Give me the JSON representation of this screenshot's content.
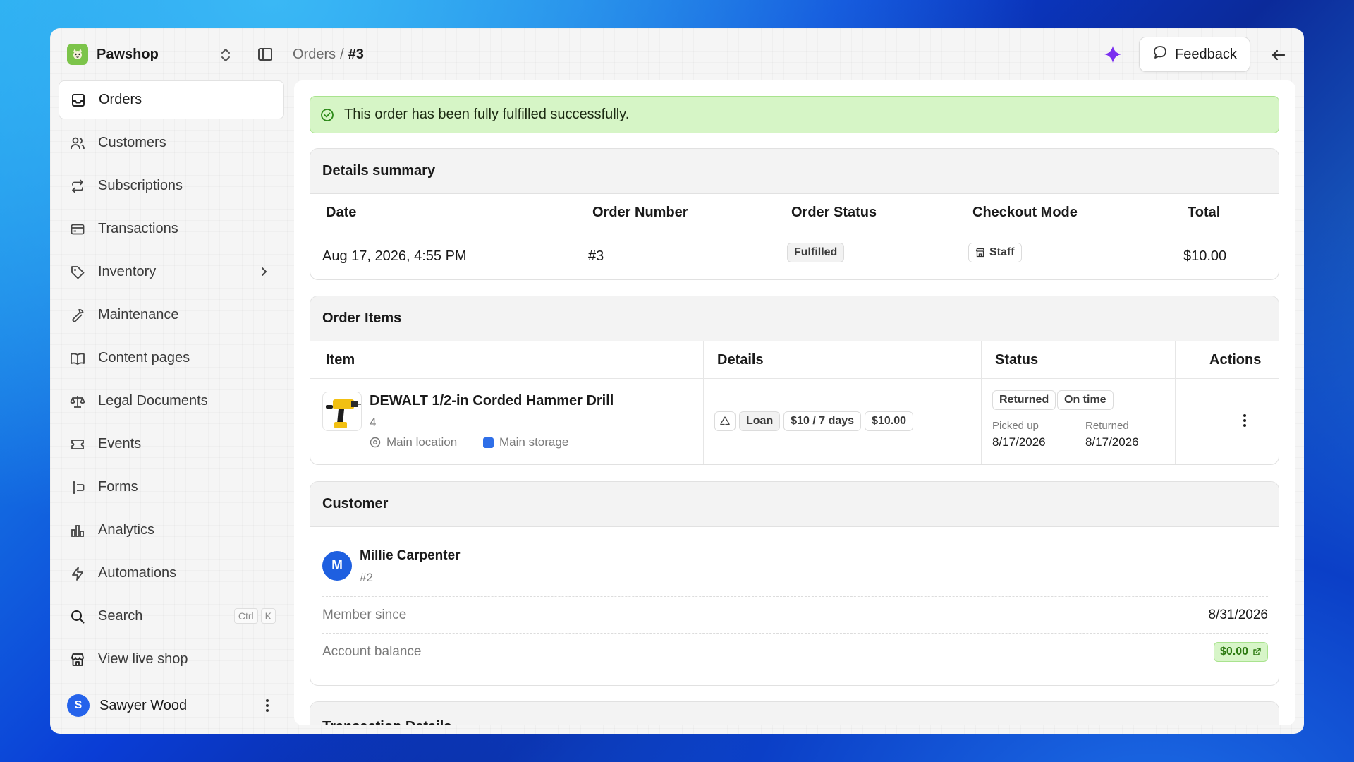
{
  "app": {
    "name": "Pawshop"
  },
  "breadcrumb": {
    "parent": "Orders",
    "separator": "/",
    "current": "#3"
  },
  "header": {
    "feedback_label": "Feedback"
  },
  "sidebar": {
    "items": [
      {
        "label": "Orders"
      },
      {
        "label": "Customers"
      },
      {
        "label": "Subscriptions"
      },
      {
        "label": "Transactions"
      },
      {
        "label": "Inventory"
      },
      {
        "label": "Maintenance"
      },
      {
        "label": "Content pages"
      },
      {
        "label": "Legal Documents"
      },
      {
        "label": "Events"
      },
      {
        "label": "Forms"
      },
      {
        "label": "Analytics"
      },
      {
        "label": "Automations"
      }
    ],
    "search": {
      "label": "Search",
      "kbd": [
        "Ctrl",
        "K"
      ]
    },
    "live_shop": {
      "label": "View live shop"
    },
    "user": {
      "initial": "S",
      "name": "Sawyer Wood"
    }
  },
  "alert": {
    "message": "This order has been fully fulfilled successfully."
  },
  "summary": {
    "title": "Details summary",
    "headers": {
      "date": "Date",
      "number": "Order Number",
      "status": "Order Status",
      "mode": "Checkout Mode",
      "total": "Total"
    },
    "row": {
      "date": "Aug 17, 2026, 4:55 PM",
      "number": "#3",
      "status": "Fulfilled",
      "mode": "Staff",
      "total": "$10.00"
    }
  },
  "items": {
    "title": "Order Items",
    "headers": {
      "item": "Item",
      "details": "Details",
      "status": "Status",
      "actions": "Actions"
    },
    "row": {
      "name": "DEWALT 1/2-in Corded Hammer Drill",
      "quantity": "4",
      "location": "Main location",
      "storage": "Main storage",
      "type": "Loan",
      "rate": "$10 / 7 days",
      "price": "$10.00",
      "status": "Returned",
      "timing": "On time",
      "picked_label": "Picked up",
      "picked_date": "8/17/2026",
      "returned_label": "Returned",
      "returned_date": "8/17/2026"
    }
  },
  "customer": {
    "title": "Customer",
    "initial": "M",
    "name": "Millie Carpenter",
    "id": "#2",
    "member_label": "Member since",
    "member_value": "8/31/2026",
    "balance_label": "Account balance",
    "balance_value": "$0.00"
  },
  "transactions": {
    "title": "Transaction Details"
  },
  "colors": {
    "accent": "#2563eb",
    "success_bg": "#d6f5c6",
    "brand": "#7cc44a",
    "storage": "#2f6fe8",
    "sparkle": "#7b2ff0"
  }
}
